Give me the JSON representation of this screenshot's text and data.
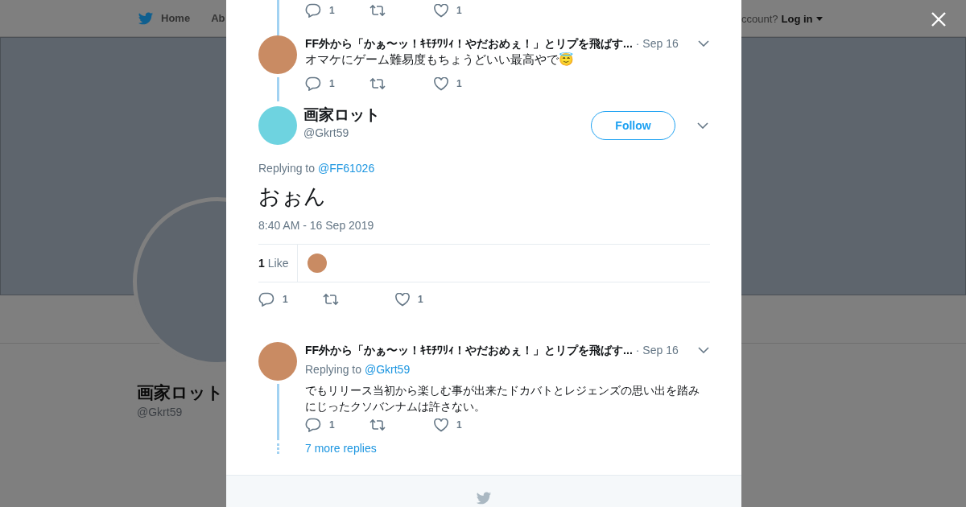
{
  "background_page": {
    "nav": [
      {
        "label": "Home",
        "kind": "home"
      },
      {
        "label": "Ab",
        "kind": "plain"
      }
    ],
    "account_prompt": "ccount?",
    "login": "Log in",
    "profile_name": "画家ロット",
    "profile_handle": "@Gkrt59"
  },
  "modal": {
    "thread_above": [
      {
        "kind": "actions_only",
        "actions": {
          "replies": "1",
          "likes": "1"
        }
      },
      {
        "kind": "tweet",
        "name": "FF外から「かぁ〜ッ！ｷﾓﾁﾜﾘｨ！やだおめぇ！」とリプを飛ばす...",
        "date": "· Sep 16",
        "text": "オマケにゲーム難易度もちょうどいい最高やで😇",
        "actions": {
          "replies": "1",
          "likes": "1"
        }
      }
    ],
    "main_tweet": {
      "name": "画家ロット",
      "handle": "@Gkrt59",
      "follow": "Follow",
      "replying_label": "Replying to",
      "replying_to": "@FF61026",
      "text": "おぉん",
      "time": "8:40 AM - 16 Sep 2019",
      "like_count": "1",
      "like_label": "Like",
      "actions": {
        "replies": "1",
        "likes": "1"
      }
    },
    "replies": [
      {
        "name": "FF外から「かぁ〜ッ！ｷﾓﾁﾜﾘｨ！やだおめぇ！」とリプを飛ばす...",
        "date": "· Sep 16",
        "replying_label": "Replying to",
        "replying_to": "@Gkrt59",
        "text": "でもリリース当初から楽しむ事が出来たドカバトとレジェンズの思い出を踏みにじったクソバンナムは許さない。",
        "actions": {
          "replies": "1",
          "likes": "1"
        }
      }
    ],
    "more_replies": "7 more replies"
  }
}
